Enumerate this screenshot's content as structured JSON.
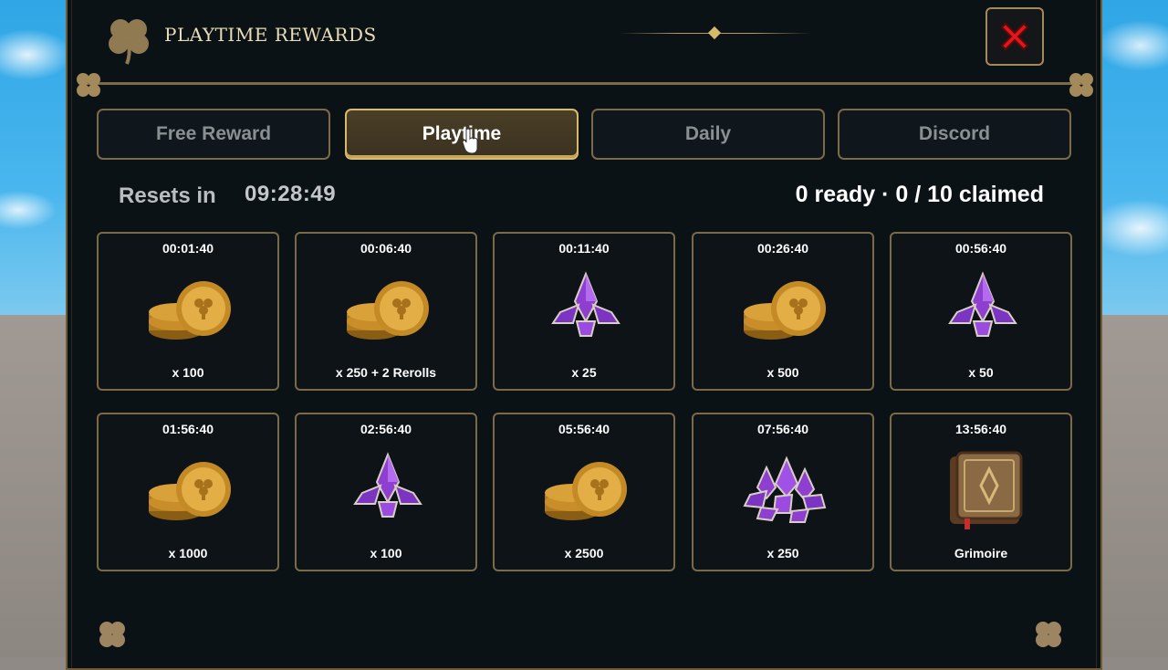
{
  "window": {
    "title": "PLAYTIME REWARDS"
  },
  "tabs": [
    {
      "label": "Free Reward",
      "active": false
    },
    {
      "label": "Playtime",
      "active": true
    },
    {
      "label": "Daily",
      "active": false
    },
    {
      "label": "Discord",
      "active": false
    }
  ],
  "status": {
    "reset_label": "Resets in",
    "reset_time": "09:28:49",
    "claim_status": "0 ready · 0 / 10 claimed"
  },
  "rewards": [
    {
      "time": "00:01:40",
      "amount": "x 100",
      "icon": "gold-coins-icon"
    },
    {
      "time": "00:06:40",
      "amount": "x 250 + 2 Rerolls",
      "icon": "gold-coins-icon"
    },
    {
      "time": "00:11:40",
      "amount": "x 25",
      "icon": "purple-crystals-icon"
    },
    {
      "time": "00:26:40",
      "amount": "x 500",
      "icon": "gold-coins-icon"
    },
    {
      "time": "00:56:40",
      "amount": "x 50",
      "icon": "purple-crystals-icon"
    },
    {
      "time": "01:56:40",
      "amount": "x 1000",
      "icon": "gold-coins-icon"
    },
    {
      "time": "02:56:40",
      "amount": "x 100",
      "icon": "purple-crystals-icon"
    },
    {
      "time": "05:56:40",
      "amount": "x 2500",
      "icon": "gold-coins-icon"
    },
    {
      "time": "07:56:40",
      "amount": "x 250",
      "icon": "purple-crystal-pile-icon"
    },
    {
      "time": "13:56:40",
      "amount": "Grimoire",
      "icon": "grimoire-book-icon"
    }
  ],
  "colors": {
    "panel_bg": "#0b1216",
    "gold_border": "#7b6a48",
    "active_tab": "#d9b96a",
    "close_red": "#e0161b"
  }
}
